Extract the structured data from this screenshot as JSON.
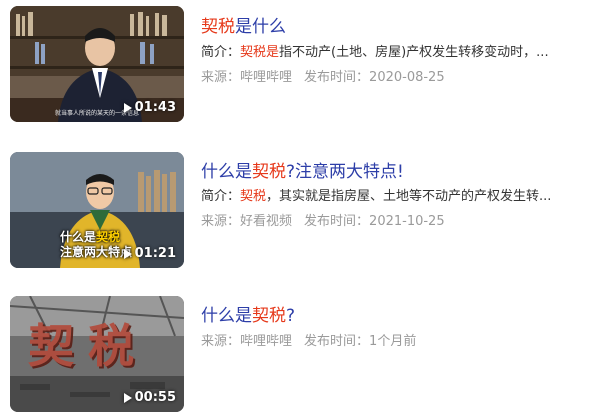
{
  "results": [
    {
      "title_pre": "",
      "title_hl": "契税",
      "title_post": "是什么",
      "summary_label": "简介：",
      "summary_hl": "契税是",
      "summary_rest": "指不动产(土地、房屋)产权发生转移变动时，...",
      "source_label": "来源：",
      "source": "哔哩哔哩",
      "date_label": "发布时间：",
      "date": "2020-08-25",
      "duration": "01:43",
      "thumb_caption": "就当事人所说的某天的一条信息"
    },
    {
      "title_pre": "什么是",
      "title_hl": "契税",
      "title_post": "?注意两大特点!",
      "summary_label": "简介：",
      "summary_hl": "契税",
      "summary_rest": "，其实就是指房屋、土地等不动产的产权发生转...",
      "source_label": "来源：",
      "source": "好看视频",
      "date_label": "发布时间：",
      "date": "2021-10-25",
      "duration": "01:21",
      "thumb_caption_a": "什么是",
      "thumb_caption_b": "契税",
      "thumb_caption_c": "注意两大特点"
    },
    {
      "title_pre": "什么是",
      "title_hl": "契税",
      "title_post": "?",
      "source_label": "来源：",
      "source": "哔哩哔哩",
      "date_label": "发布时间：",
      "date": "1个月前",
      "duration": "00:55",
      "thumb_glyphs": "契税"
    }
  ],
  "colors": {
    "title": "#2d3ea8",
    "highlight": "#e6391b",
    "meta": "#9a9a9a"
  },
  "icons": {
    "play": "play-icon"
  }
}
